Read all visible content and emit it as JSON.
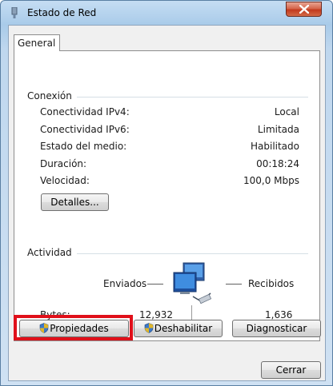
{
  "window": {
    "title": "Estado de Red"
  },
  "tabs": [
    {
      "label": "General"
    }
  ],
  "connection": {
    "group_label": "Conexión",
    "rows": [
      {
        "label": "Conectividad IPv4:",
        "value": "Local"
      },
      {
        "label": "Conectividad IPv6:",
        "value": "Limitada"
      },
      {
        "label": "Estado del medio:",
        "value": "Habilitado"
      },
      {
        "label": "Duración:",
        "value": "00:18:24"
      },
      {
        "label": "Velocidad:",
        "value": "100,0 Mbps"
      }
    ],
    "details_button": "Detalles..."
  },
  "activity": {
    "group_label": "Actividad",
    "sent_label": "Enviados",
    "received_label": "Recibidos",
    "bytes_label": "Bytes:",
    "bytes_sent": "12,932",
    "bytes_received": "1,636"
  },
  "buttons": {
    "properties": "Propiedades",
    "disable": "Deshabilitar",
    "diagnose": "Diagnosticar",
    "close": "Cerrar"
  },
  "icons": {
    "title": "network-adapter-icon",
    "close": "close-icon",
    "activity": "network-computers-icon",
    "uac": "uac-shield-icon"
  },
  "colors": {
    "highlight": "#e0101a",
    "close_button": "#c2391d"
  }
}
